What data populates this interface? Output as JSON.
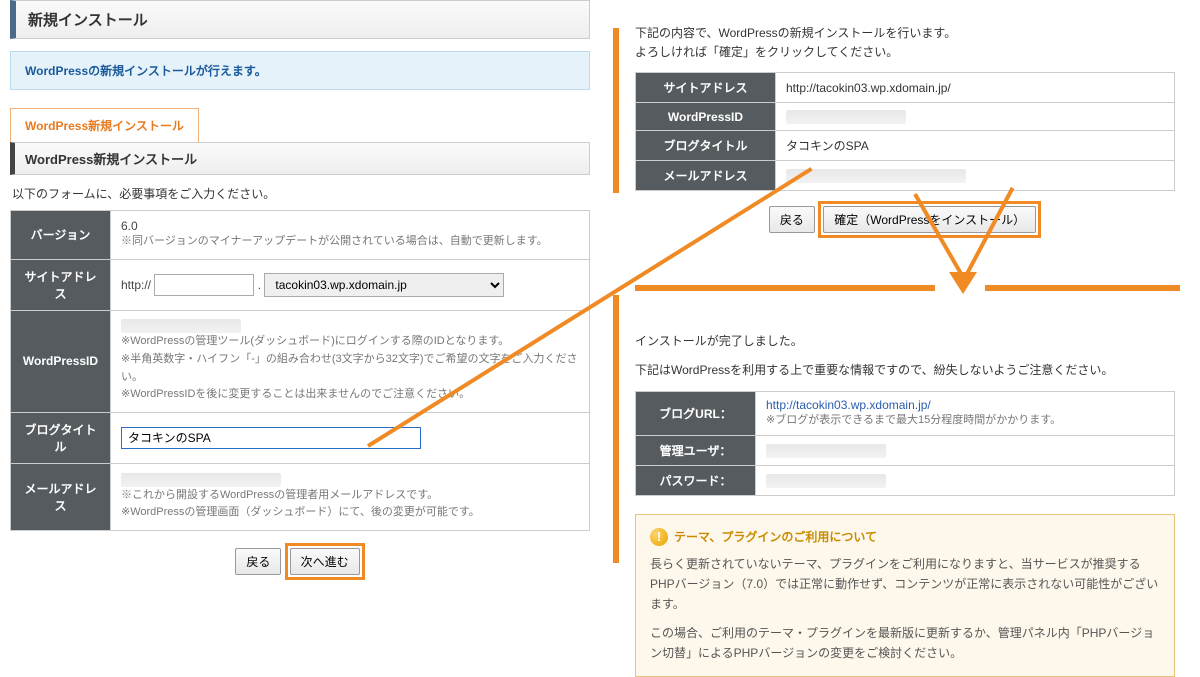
{
  "left": {
    "main_title": "新規インストール",
    "blue_notice": "WordPressの新規インストールが行えます。",
    "tab_label": "WordPress新規インストール",
    "sub_title": "WordPress新規インストール",
    "form_intro": "以下のフォームに、必要事項をご入力ください。",
    "rows": {
      "version_label": "バージョン",
      "version_value": "6.0",
      "version_note": "※同バージョンのマイナーアップデートが公開されている場合は、自動で更新します。",
      "site_label": "サイトアドレス",
      "site_scheme": "http://",
      "site_domain_option": "tacokin03.wp.xdomain.jp",
      "wpid_label": "WordPressID",
      "wpid_note1": "※WordPressの管理ツール(ダッシュボード)にログインする際のIDとなります。",
      "wpid_note2": "※半角英数字・ハイフン「-」の組み合わせ(3文字から32文字)でご希望の文字をご入力ください。",
      "wpid_note3": "※WordPressIDを後に変更することは出来ませんのでご注意ください。",
      "blog_label": "ブログタイトル",
      "blog_value": "タコキンのSPA",
      "mail_label": "メールアドレス",
      "mail_note1": "※これから開設するWordPressの管理者用メールアドレスです。",
      "mail_note2": "※WordPressの管理画面（ダッシュボード）にて、後の変更が可能です。"
    },
    "buttons": {
      "back": "戻る",
      "next": "次へ進む"
    }
  },
  "right": {
    "confirm_intro1": "下記の内容で、WordPressの新規インストールを行います。",
    "confirm_intro2": "よろしければ「確定」をクリックしてください。",
    "conf": {
      "site_label": "サイトアドレス",
      "site_value": "http://tacokin03.wp.xdomain.jp/",
      "wpid_label": "WordPressID",
      "blog_label": "ブログタイトル",
      "blog_value": "タコキンのSPA",
      "mail_label": "メールアドレス"
    },
    "buttons": {
      "back": "戻る",
      "confirm": "確定（WordPressをインストール）"
    },
    "done_text": "インストールが完了しました。",
    "done_note": "下記はWordPressを利用する上で重要な情報ですので、紛失しないようご注意ください。",
    "result": {
      "url_label": "ブログURL：",
      "url_value": "http://tacokin03.wp.xdomain.jp/",
      "url_note": "※ブログが表示できるまで最大15分程度時間がかかります。",
      "user_label": "管理ユーザ：",
      "pass_label": "パスワード："
    },
    "warn": {
      "title": "テーマ、プラグインのご利用について",
      "p1": "長らく更新されていないテーマ、プラグインをご利用になりますと、当サービスが推奨するPHPバージョン（7.0）では正常に動作せず、コンテンツが正常に表示されない可能性がございます。",
      "p2": "この場合、ご利用のテーマ・プラグインを最新版に更新するか、管理パネル内「PHPバージョン切替」によるPHPバージョンの変更をご検討ください。"
    }
  }
}
